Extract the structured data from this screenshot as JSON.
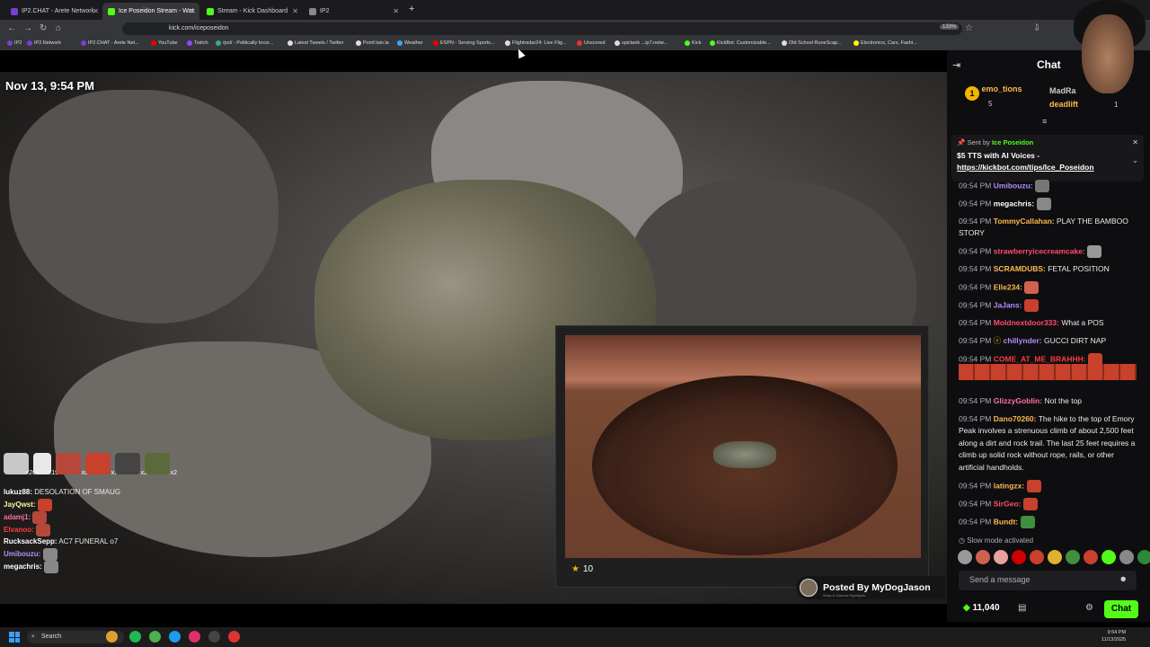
{
  "browser": {
    "tabs": [
      {
        "title": "IP2.CHAT - Arete Network",
        "color": "#7a3fd6"
      },
      {
        "title": "Ice Poseidon Stream - Wat",
        "color": "#53fc18"
      },
      {
        "title": "Stream - Kick Dashboard",
        "color": "#53fc18"
      },
      {
        "title": "IP2",
        "color": "#888888"
      }
    ],
    "url": "kick.com/iceposeidon",
    "zoom": "133%"
  },
  "bookmarks": [
    "IP2",
    "IP2.Network",
    "IP2.CHAT - Arete Net...",
    "YouTube",
    "Twitch",
    "/pol/ - Politically Incor...",
    "Latest Tweets / Twitter",
    "Pomf.lain.la",
    "Weather",
    "ESPN - Serving Sports...",
    "Flightradar24: Live Flig...",
    "Unscored",
    "spictank ...ip7.netw...",
    "Kick",
    "KickBot: Customizable...",
    "Old School RuneScap...",
    "Electronics, Cars, Fashi..."
  ],
  "video": {
    "timestamp": "Nov 13, 9:54 PM",
    "overlay_stars": "10",
    "posted_by": "Posted By MyDogJason",
    "posted_sub": "Wrap.tv Discord Highlights"
  },
  "overlay_emotes": [
    {
      "count": "x26",
      "color": "#c8c8c8"
    },
    {
      "count": "x19",
      "color": "#e8e8e8"
    },
    {
      "count": "x8",
      "color": "#b5483a"
    },
    {
      "count": "x7",
      "color": "#c9402c"
    },
    {
      "count": "x2",
      "color": "#444444"
    },
    {
      "count": "x2",
      "color": "#5a6a3a"
    }
  ],
  "overlay_chat": [
    {
      "user": "lukuz88:",
      "msg": "DESOLATION OF SMAUG",
      "color": "#ffffff"
    },
    {
      "user": "JayQwst:",
      "msg": "",
      "color": "#f5f5a0"
    },
    {
      "user": "adamj1:",
      "msg": "",
      "color": "#ff6fa0"
    },
    {
      "user": "Elvanoo:",
      "msg": "",
      "color": "#ff3b3b"
    },
    {
      "user": "RucksackSepp:",
      "msg": "AC7 FUNERAL o7",
      "color": "#ffffff"
    },
    {
      "user": "Umibouzu:",
      "msg": "",
      "color": "#b48cff"
    },
    {
      "user": "megachris:",
      "msg": "",
      "color": "#ffffff"
    }
  ],
  "chat": {
    "title": "Chat",
    "leaders": {
      "first_rank": "1",
      "first_name": "emo_tions",
      "first_count": "5",
      "second_name": "MadRa",
      "third_name": "deadlift",
      "third_count": "1"
    },
    "pinned": {
      "sent_by_label": "Sent by",
      "sender": "Ice Poseidon",
      "message": "$5 TTS with AI Voices - ",
      "link": "https://kickbot.com/tips/Ice_Poseidon"
    },
    "messages": [
      {
        "time": "09:54 PM",
        "user": "Umibouzu:",
        "text": "",
        "color": "#b48cff",
        "emote": "#777777"
      },
      {
        "time": "09:54 PM",
        "user": "megachris:",
        "text": "",
        "color": "#ffffff",
        "emote": "#888888"
      },
      {
        "time": "09:54 PM",
        "user": "TommyCallahan:",
        "text": "PLAY THE BAMBOO STORY",
        "color": "#ffb84d",
        "emote": ""
      },
      {
        "time": "09:54 PM",
        "user": "strawberryicecreamcake:",
        "text": "",
        "color": "#ff4d6d",
        "emote": "#999999"
      },
      {
        "time": "09:54 PM",
        "user": "SCRAMDUBS:",
        "text": "FETAL POSITION",
        "color": "#ffb84d",
        "emote": ""
      },
      {
        "time": "09:54 PM",
        "user": "Elle234:",
        "text": "",
        "color": "#ffb84d",
        "emote": "#d06050"
      },
      {
        "time": "09:54 PM",
        "user": "JaJans:",
        "text": "",
        "color": "#b48cff",
        "emote": "#c9402c"
      },
      {
        "time": "09:54 PM",
        "user": "Moldnextdoor333:",
        "text": "What a POS",
        "color": "#ff4d6d",
        "emote": ""
      },
      {
        "time": "09:54 PM",
        "user": "chillynder:",
        "text": "GUCCI DIRT NAP",
        "color": "#b48cff",
        "emote": ""
      },
      {
        "time": "09:54 PM",
        "user": "COME_AT_ME_BRAHHH:",
        "text": "",
        "color": "#ff3b3b",
        "emote": "#c9402c"
      },
      {
        "time": "09:54 PM",
        "user": "GlizzyGoblin:",
        "text": "Not the top",
        "color": "#ff6fa0",
        "emote": ""
      },
      {
        "time": "09:54 PM",
        "user": "Dano70260:",
        "text": "The hike to the top of Emory Peak involves a strenuous climb of about 2,500 feet along a dirt and rock trail. The last 25 feet requires a climb up solid rock without rope, rails, or other artificial handholds.",
        "color": "#ffb84d",
        "emote": ""
      },
      {
        "time": "09:54 PM",
        "user": "latingzx:",
        "text": "",
        "color": "#ffb84d",
        "emote": "#c9402c"
      },
      {
        "time": "09:54 PM",
        "user": "SirGeo:",
        "text": "",
        "color": "#ff4d6d",
        "emote": "#c9402c"
      },
      {
        "time": "09:54 PM",
        "user": "Bundt:",
        "text": "",
        "color": "#ffb84d",
        "emote": "#3f8f3f"
      }
    ],
    "slow_mode": "Slow mode activated",
    "placeholder": "Send a message",
    "points": "11,040",
    "chat_button": "Chat",
    "accent": "#53fc18"
  },
  "taskbar": {
    "search": "Search",
    "time": "9:54 PM",
    "date": "11/13/2025"
  }
}
